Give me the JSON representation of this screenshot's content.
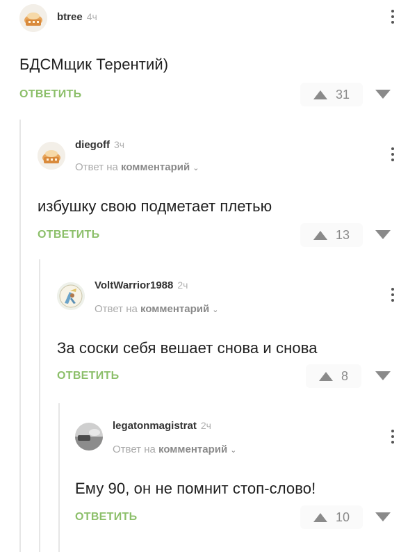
{
  "comments": [
    {
      "author": "btree",
      "time": "4ч",
      "reply_to_prefix": "",
      "reply_to_link": "",
      "text": "БДСМщик Терентий)",
      "reply_label": "ОТВЕТИТЬ",
      "score": "31",
      "avatar_icon": "bread-avatar-icon"
    },
    {
      "author": "diegoff",
      "time": "3ч",
      "reply_to_prefix": "Ответ на",
      "reply_to_link": "комментарий",
      "text": "избушку свою подметает плетью",
      "reply_label": "ОТВЕТИТЬ",
      "score": "13",
      "avatar_icon": "bread-avatar-icon"
    },
    {
      "author": "VoltWarrior1988",
      "time": "2ч",
      "reply_to_prefix": "Ответ на",
      "reply_to_link": "комментарий",
      "text": "За соски себя вешает снова и снова",
      "reply_label": "ОТВЕТИТЬ",
      "score": "8",
      "avatar_icon": "warrior-avatar-icon"
    },
    {
      "author": "legatonmagistrat",
      "time": "2ч",
      "reply_to_prefix": "Ответ на",
      "reply_to_link": "комментарий",
      "text": "Ему 90, он не помнит стоп-слово!",
      "reply_label": "ОТВЕТИТЬ",
      "score": "10",
      "avatar_icon": "photo-avatar-icon"
    }
  ],
  "colors": {
    "reply_green": "#8cbf6a",
    "vote_gray": "#8a8a8a",
    "thread_line": "#e6e6e6"
  }
}
